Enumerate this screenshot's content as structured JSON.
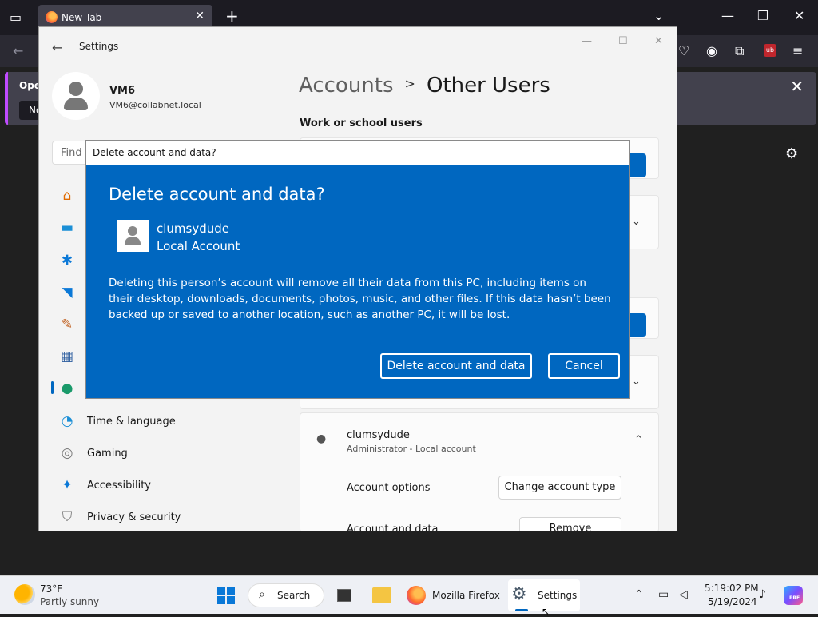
{
  "firefox": {
    "tab_title": "New Tab",
    "notification_title": "Oper",
    "notification_button": "No"
  },
  "settings": {
    "app_title": "Settings",
    "user": {
      "name": "VM6",
      "email": "VM6@collabnet.local"
    },
    "find_placeholder": "Find",
    "nav": [
      {
        "label": "Time & language",
        "icon": "globe-clock-icon"
      },
      {
        "label": "Gaming",
        "icon": "gamepad-icon"
      },
      {
        "label": "Accessibility",
        "icon": "accessibility-icon"
      },
      {
        "label": "Privacy & security",
        "icon": "shield-icon"
      }
    ],
    "breadcrumb": {
      "parent": "Accounts",
      "current": "Other Users"
    },
    "section_label": "Work or school users",
    "user_card": {
      "name": "clumsydude",
      "subtitle": "Administrator - Local account",
      "account_options_label": "Account options",
      "account_options_button": "Change account type",
      "account_data_label": "Account and data",
      "account_data_button": "Remove"
    }
  },
  "dialog": {
    "window_title": "Delete account and data?",
    "heading": "Delete account and data?",
    "user_name": "clumsydude",
    "account_type": "Local Account",
    "message": "Deleting this person’s account will remove all their data from this PC, including items on their desktop, downloads, documents, photos, music, and other files. If this data hasn’t been backed up or saved to another location, such as another PC, it will be lost.",
    "confirm_button": "Delete account and data",
    "cancel_button": "Cancel"
  },
  "taskbar": {
    "weather_temp": "73°F",
    "weather_condition": "Partly sunny",
    "search_label": "Search",
    "firefox_label": "Mozilla Firefox",
    "settings_label": "Settings",
    "time": "5:19:02 PM",
    "date": "5/19/2024",
    "copilot_badge": "PRE"
  },
  "colors": {
    "accent": "#0067c0",
    "dialog_background": "#0067c0",
    "firefox_tabbar": "#1c1b22"
  }
}
